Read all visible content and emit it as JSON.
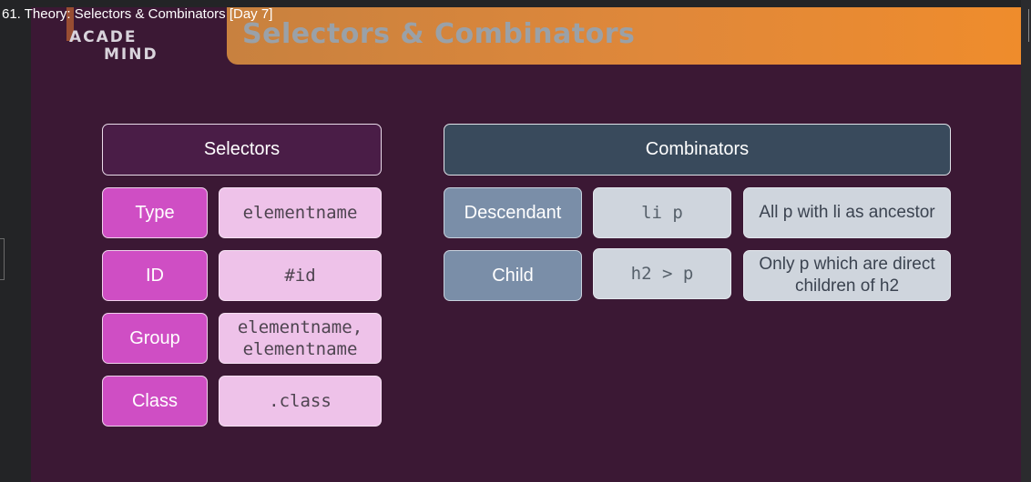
{
  "video": {
    "title": "61. Theory: Selectors & Combinators [Day 7]"
  },
  "slide": {
    "logo": {
      "line1": "ACADE",
      "line2": "MIND"
    },
    "title": "Selectors & Combinators",
    "selectors": {
      "heading": "Selectors",
      "rows": [
        {
          "label": "Type",
          "example": "elementname"
        },
        {
          "label": "ID",
          "example": "#id"
        },
        {
          "label": "Group",
          "example": "elementname,\nelementname"
        },
        {
          "label": "Class",
          "example": ".class"
        }
      ]
    },
    "combinators": {
      "heading": "Combinators",
      "rows": [
        {
          "label": "Descendant",
          "example": "li p",
          "description": "All p with li as ancestor"
        },
        {
          "label": "Child",
          "example": "h2 > p",
          "description": "Only p which are direct children of h2"
        }
      ]
    }
  },
  "colors": {
    "slide_background": "#3b1834",
    "header_orange": "#e0883a",
    "selector_magenta": "#cf4ec4",
    "selector_pink": "#eec2e9",
    "combinator_slate": "#394a5c",
    "combinator_blue_gray": "#7a8ea8",
    "combinator_light": "#cfd5dd"
  }
}
